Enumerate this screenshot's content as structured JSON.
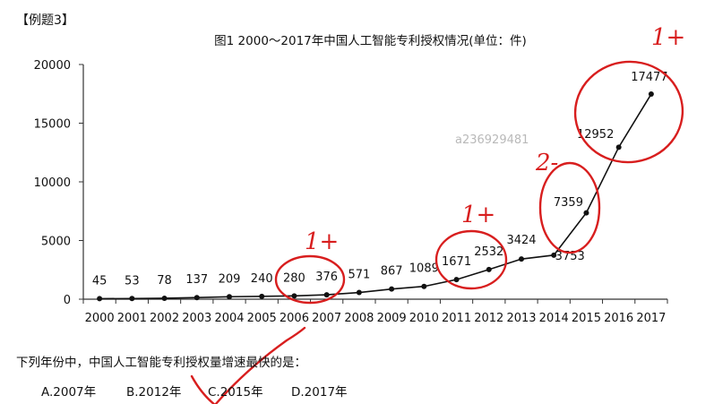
{
  "example_tag": "【例题3】",
  "watermark": "a236929481",
  "question": "下列年份中，中国人工智能专利授权量增速最快的是：",
  "options": [
    "A.2007年",
    "B.2012年",
    "C.2015年",
    "D.2017年"
  ],
  "annotations": [
    "1+",
    "1+",
    "2-",
    "1+"
  ],
  "colors": {
    "line": "#111111",
    "annotation": "#d81e1e",
    "axis": "#333333"
  },
  "chart_data": {
    "type": "line",
    "title": "图1  2000～2017年中国人工智能专利授权情况(单位：件)",
    "categories": [
      "2000",
      "2001",
      "2002",
      "2003",
      "2004",
      "2005",
      "2006",
      "2007",
      "2008",
      "2009",
      "2010",
      "2011",
      "2012",
      "2013",
      "2014",
      "2015",
      "2016",
      "2017"
    ],
    "values": [
      45,
      53,
      78,
      137,
      209,
      240,
      280,
      376,
      571,
      867,
      1089,
      1671,
      2532,
      3424,
      3753,
      7359,
      12952,
      17477
    ],
    "ylim": [
      0,
      20000
    ],
    "yticks": [
      "0",
      "5000",
      "10000",
      "15000",
      "20000"
    ],
    "grid": false
  }
}
